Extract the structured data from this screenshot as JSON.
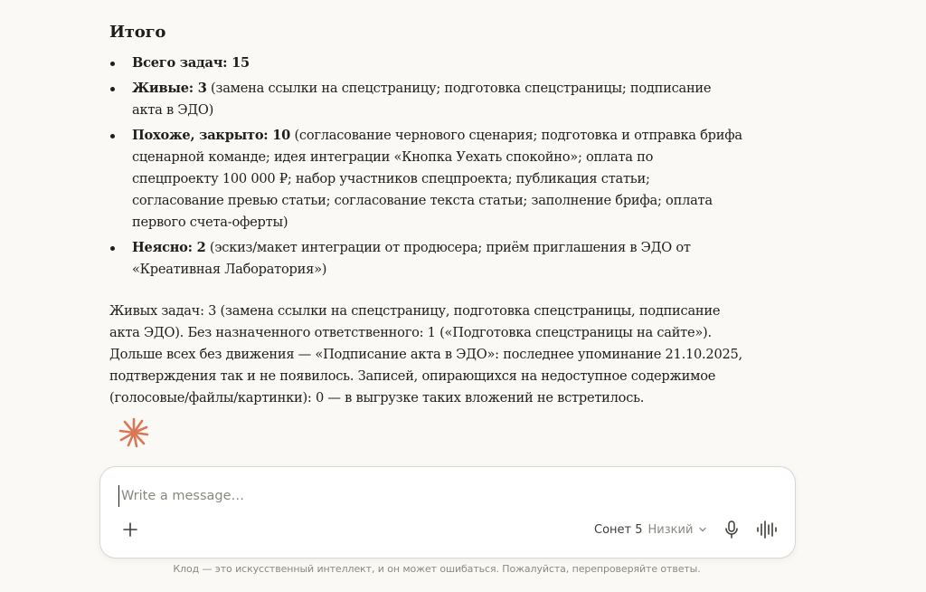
{
  "summary": {
    "heading": "Итого",
    "items": [
      {
        "bold": "Всего задач: 15",
        "rest": ""
      },
      {
        "bold": "Живые: 3",
        "rest": " (замена ссылки на спецстраницу; подготовка спецстраницы; подписание акта в ЭДО)"
      },
      {
        "bold": "Похоже, закрыто: 10",
        "rest": " (согласование чернового сценария; подготовка и отправка брифа сценарной команде; идея интеграции «Кнопка Уехать спокойно»; оплата по спецпроекту 100 000 ₽; набор участников спецпроекта; публикация статьи; согласование превью статьи; согласование текста статьи; заполнение брифа; оплата первого счета-оферты)"
      },
      {
        "bold": "Неясно: 2",
        "rest": " (эскиз/макет интеграции от продюсера; приём приглашения в ЭДО от «Креативная Лаборатория»)"
      }
    ],
    "paragraph": "Живых задач: 3 (замена ссылки на спецстраницу, подготовка спецстраницы, подписание акта ЭДО). Без назначенного ответственного: 1 («Подготовка спецстраницы на сайте»). Дольше всех без движения — «Подписание акта в ЭДО»: последнее упоминание 21.10.2025, подтверждения так и не появилось. Записей, опирающихся на недоступное содержимое (голосовые/файлы/картинки): 0 — в выгрузке таких вложений не встретилось."
  },
  "composer": {
    "placeholder": "Write a message…",
    "value": "",
    "model_name": "Сонет 5",
    "effort": "Низкий",
    "icons": {
      "spark": "claude-spark-icon",
      "plus": "plus-icon",
      "chevron": "chevron-down-icon",
      "mic": "microphone-icon",
      "voice": "voice-waveform-icon"
    }
  },
  "disclaimer": "Клод — это искусственный интеллект, и он может ошибаться. Пожалуйста, перепроверяйте ответы.",
  "colors": {
    "background": "#faf9f5",
    "text": "#1f1e1d",
    "accent": "#d97757",
    "muted": "#8a8880"
  }
}
